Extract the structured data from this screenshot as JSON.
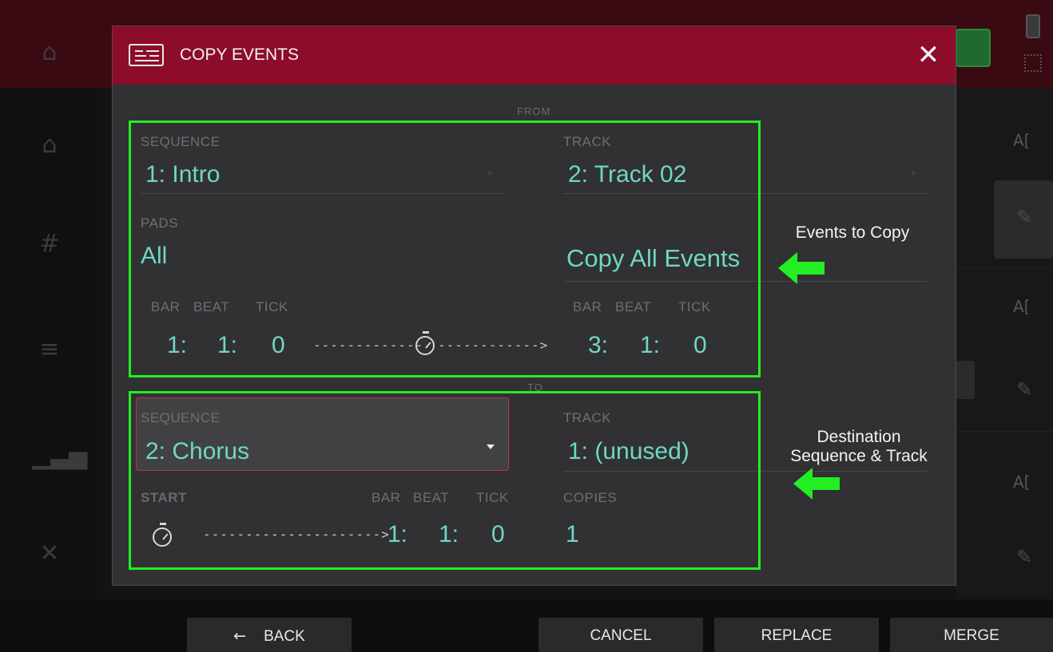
{
  "dialog": {
    "title": "COPY EVENTS",
    "from_label": "FROM",
    "to_label": "TO"
  },
  "from": {
    "sequence_label": "SEQUENCE",
    "sequence_value": "1: Intro",
    "track_label": "TRACK",
    "track_value": "2: Track 02",
    "pads_label": "PADS",
    "pads_value": "All",
    "events_value": "Copy All Events",
    "start": {
      "bar_label": "BAR",
      "beat_label": "BEAT",
      "tick_label": "TICK",
      "bar": "1:",
      "beat": "1:",
      "tick": "0"
    },
    "end": {
      "bar_label": "BAR",
      "beat_label": "BEAT",
      "tick_label": "TICK",
      "bar": "3:",
      "beat": "1:",
      "tick": "0"
    },
    "range_arrow_left": "------------- ",
    "range_arrow_right": " ------------>"
  },
  "to": {
    "sequence_label": "SEQUENCE",
    "sequence_value": "2: Chorus",
    "track_label": "TRACK",
    "track_value": "1: (unused)",
    "start_label": "START",
    "start_arrow": "--------------------->",
    "bar_label": "BAR",
    "beat_label": "BEAT",
    "tick_label": "TICK",
    "bar": "1:",
    "beat": "1:",
    "tick": "0",
    "copies_label": "COPIES",
    "copies_value": "1"
  },
  "annotations": {
    "events_to_copy": "Events to Copy",
    "destination_line1": "Destination",
    "destination_line2": "Sequence & Track",
    "color": "#22ee22"
  },
  "footer": {
    "back_arrow": "←",
    "back_label": "BACK",
    "cancel_label": "CANCEL",
    "replace_label": "REPLACE",
    "merge_label": "MERGE"
  },
  "background": {
    "ai_label": "A[",
    "pencil_icon": "pencil-icon"
  },
  "colors": {
    "header": "#8c0c2a",
    "value_text": "#6fd7c4",
    "highlight": "#22ee22",
    "selected_border": "#c0324a"
  }
}
